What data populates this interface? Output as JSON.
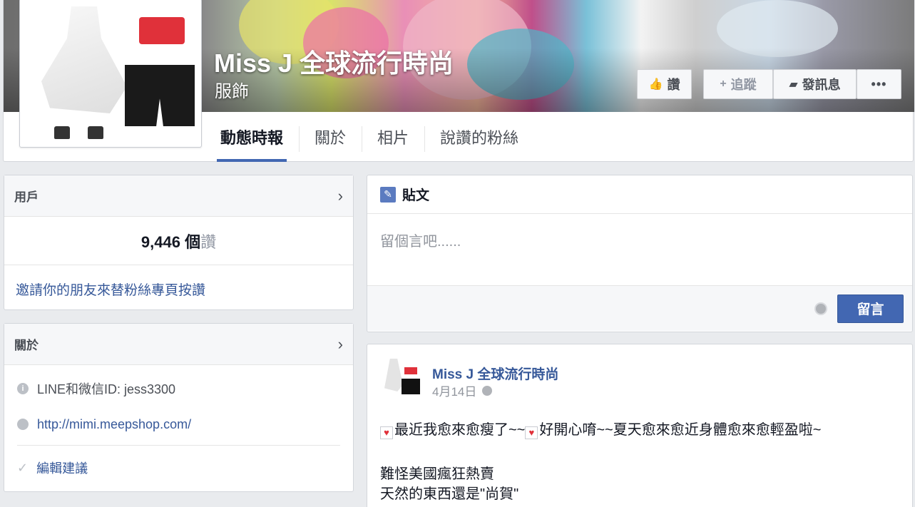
{
  "page": {
    "name": "Miss J 全球流行時尚",
    "category": "服飾"
  },
  "cover_buttons": {
    "like": "讚",
    "follow": "追蹤",
    "message": "發訊息",
    "more": "•••"
  },
  "tabs": [
    "動態時報",
    "關於",
    "相片",
    "說讚的粉絲"
  ],
  "likes_card": {
    "title": "用戶",
    "count": "9,446 個",
    "count_suffix": "讚",
    "invite": "邀請你的朋友來替粉絲專頁按讚"
  },
  "about_card": {
    "title": "關於",
    "line_id": "LINE和微信ID: jess3300",
    "website": "http://mimi.meepshop.com/",
    "edit": "編輯建議"
  },
  "composer": {
    "title": "貼文",
    "placeholder": "留個言吧......",
    "submit": "留言"
  },
  "post": {
    "author": "Miss J 全球流行時尚",
    "date": "4月14日",
    "line1_part1": "最近我愈來愈瘦了~~",
    "line1_part2": "好開心唷~~夏天愈來愈近身體愈來愈輕盈啦~",
    "line2": "難怪美國瘋狂熱賣",
    "line3": "天然的東西還是\"尚賀\""
  },
  "colors": {
    "accent": "#4267b2",
    "link": "#365899",
    "background": "#e9ebee"
  },
  "icons": [
    "thumbs-up-icon",
    "plus-icon",
    "message-icon",
    "more-icon",
    "chevron-right-icon",
    "info-icon",
    "globe-icon",
    "check-icon",
    "pencil-icon",
    "heart-icon"
  ]
}
